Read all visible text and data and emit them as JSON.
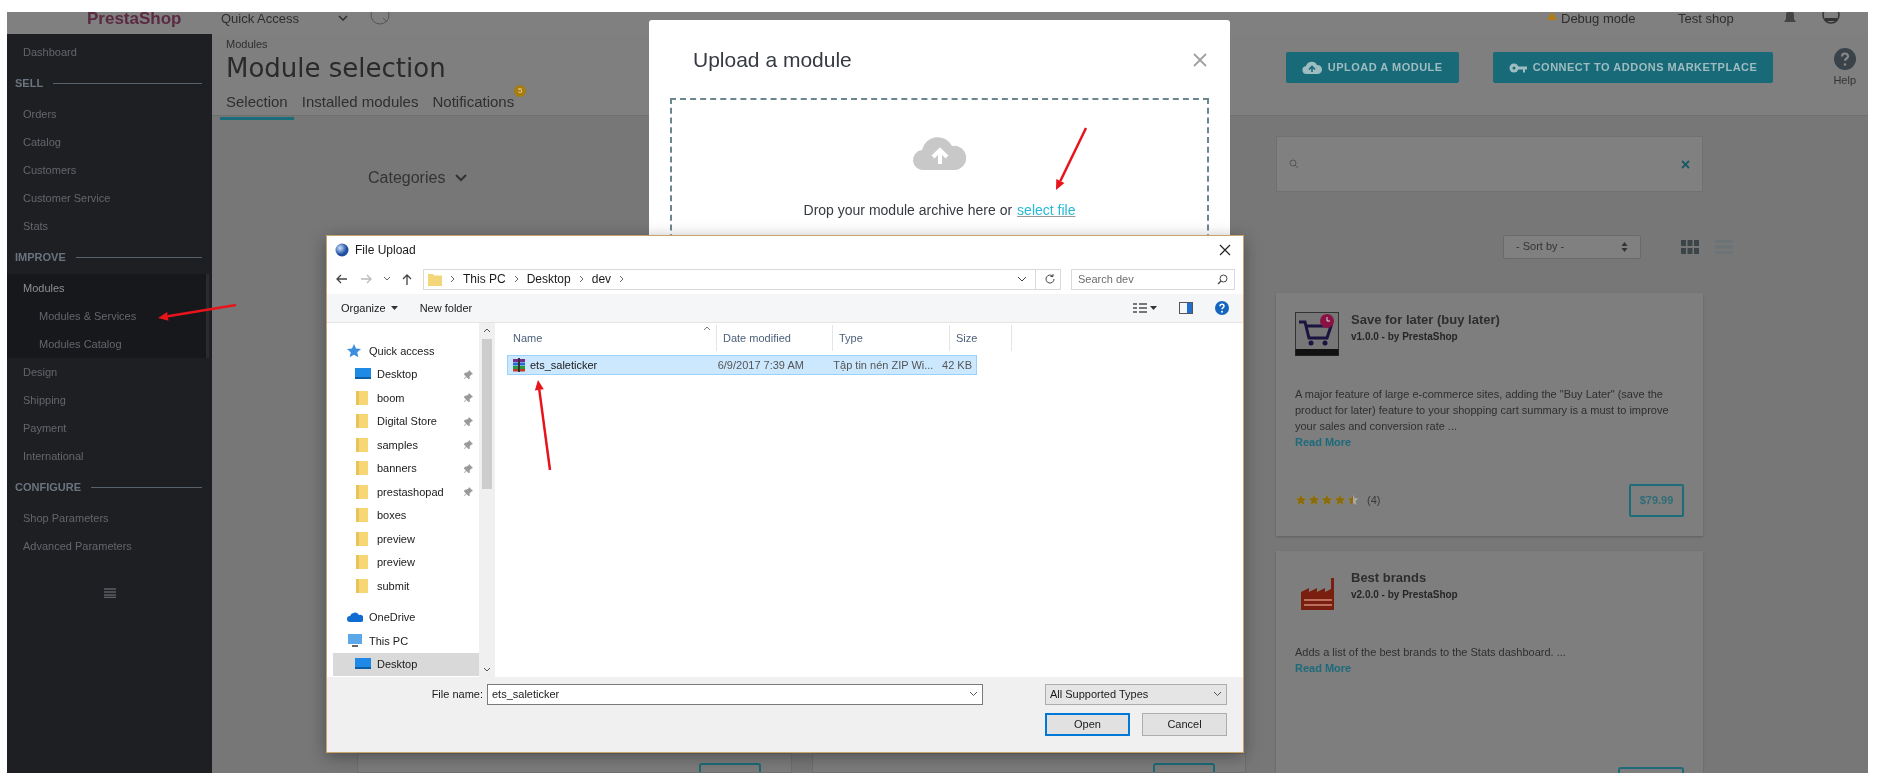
{
  "header": {
    "logo": "PrestaShop",
    "quick_access": "Quick Access",
    "debug_mode": "Debug mode",
    "shop": "Test shop"
  },
  "sidebar": [
    {
      "kind": "link",
      "label": "Dashboard",
      "selected": false
    },
    {
      "kind": "heading",
      "label": "SELL"
    },
    {
      "kind": "link",
      "label": "Orders",
      "selected": false
    },
    {
      "kind": "link",
      "label": "Catalog",
      "selected": false
    },
    {
      "kind": "link",
      "label": "Customers",
      "selected": false
    },
    {
      "kind": "link",
      "label": "Customer Service",
      "selected": false
    },
    {
      "kind": "link",
      "label": "Stats",
      "selected": false
    },
    {
      "kind": "heading",
      "label": "IMPROVE"
    },
    {
      "kind": "link",
      "label": "Modules",
      "selected": true,
      "expanded": true,
      "children": [
        {
          "label": "Modules & Services"
        },
        {
          "label": "Modules Catalog"
        }
      ]
    },
    {
      "kind": "link",
      "label": "Design",
      "selected": false
    },
    {
      "kind": "link",
      "label": "Shipping",
      "selected": false
    },
    {
      "kind": "link",
      "label": "Payment",
      "selected": false
    },
    {
      "kind": "link",
      "label": "International",
      "selected": false
    },
    {
      "kind": "heading",
      "label": "CONFIGURE"
    },
    {
      "kind": "link",
      "label": "Shop Parameters",
      "selected": false
    },
    {
      "kind": "link",
      "label": "Advanced Parameters",
      "selected": false
    }
  ],
  "page": {
    "breadcrumb": "Modules",
    "title": "Module selection",
    "tabs": [
      {
        "label": "Selection",
        "selected": true
      },
      {
        "label": "Installed modules",
        "selected": false
      },
      {
        "label": "Notifications",
        "selected": false,
        "badge": "5"
      }
    ],
    "actions": [
      {
        "label": "UPLOAD A MODULE",
        "kind": "upload"
      },
      {
        "label": "CONNECT TO ADDONS MARKETPLACE",
        "kind": "connect"
      }
    ],
    "help": "Help"
  },
  "filters": {
    "categories": "Categories",
    "sort": "- Sort by -",
    "views": [
      {
        "kind": "grid",
        "selected": true
      },
      {
        "kind": "list",
        "selected": false
      }
    ]
  },
  "modules": [
    {
      "name": "Save for later (buy later)",
      "kind": "cart",
      "meta": "v1.0.0 - by **PrestaShop**",
      "description": "A major feature of large e-commerce sites, adding the \"Buy Later\" (save the product for later) feature to your shopping cart summary is a must to improve your sales and conversion rate ...",
      "read_more": "Read More",
      "stars": 4.5,
      "rating_count": "(4)",
      "price": "$79.99"
    },
    {
      "name": "Best brands",
      "kind": "factory",
      "meta": "v2.0.0 - by **PrestaShop**",
      "description": "Adds a list of the best brands to the Stats dashboard. ...",
      "read_more": "Read More"
    }
  ],
  "upload_modal": {
    "title": "Upload a module",
    "drop_text": "Drop your module archive here or",
    "select_link": "select file"
  },
  "file_dialog": {
    "title": "File Upload",
    "path": [
      "This PC",
      "Desktop",
      "dev"
    ],
    "search_placeholder": "Search dev",
    "toolbar": [
      {
        "label": "Organize",
        "dropdown": true
      },
      {
        "label": "New folder",
        "dropdown": false
      }
    ],
    "nav": [
      {
        "kind": "star",
        "label": "Quick access",
        "pinned": false,
        "selected": false
      },
      {
        "kind": "desktop",
        "label": "Desktop",
        "pinned": true,
        "selected": false
      },
      {
        "kind": "folder",
        "label": "boom",
        "pinned": true,
        "selected": false
      },
      {
        "kind": "folder",
        "label": "Digital Store",
        "pinned": true,
        "selected": false
      },
      {
        "kind": "folder",
        "label": "samples",
        "pinned": true,
        "selected": false
      },
      {
        "kind": "folder",
        "label": "banners",
        "pinned": true,
        "selected": false
      },
      {
        "kind": "folder",
        "label": "prestashopad",
        "pinned": true,
        "selected": false
      },
      {
        "kind": "folder",
        "label": "boxes",
        "pinned": false,
        "selected": false
      },
      {
        "kind": "folder",
        "label": "preview",
        "pinned": false,
        "selected": false
      },
      {
        "kind": "folder",
        "label": "preview",
        "pinned": false,
        "selected": false
      },
      {
        "kind": "folder",
        "label": "submit",
        "pinned": false,
        "selected": false
      },
      {
        "kind": "cloud",
        "label": "OneDrive",
        "pinned": false,
        "selected": false
      },
      {
        "kind": "pc",
        "label": "This PC",
        "pinned": false,
        "selected": false
      },
      {
        "kind": "desktop",
        "label": "Desktop",
        "pinned": false,
        "selected": true
      }
    ],
    "columns": [
      "Name",
      "Date modified",
      "Type",
      "Size"
    ],
    "files": [
      {
        "name": "ets_saleticker",
        "date": "6/9/2017 7:39 AM",
        "type": "Tập tin nén ZIP Wi...",
        "size": "42 KB",
        "selected": true
      }
    ],
    "file_name_label": "File name:",
    "file_name": "ets_saleticker",
    "file_type": "All Supported Types",
    "buttons": [
      "Open",
      "Cancel"
    ]
  }
}
